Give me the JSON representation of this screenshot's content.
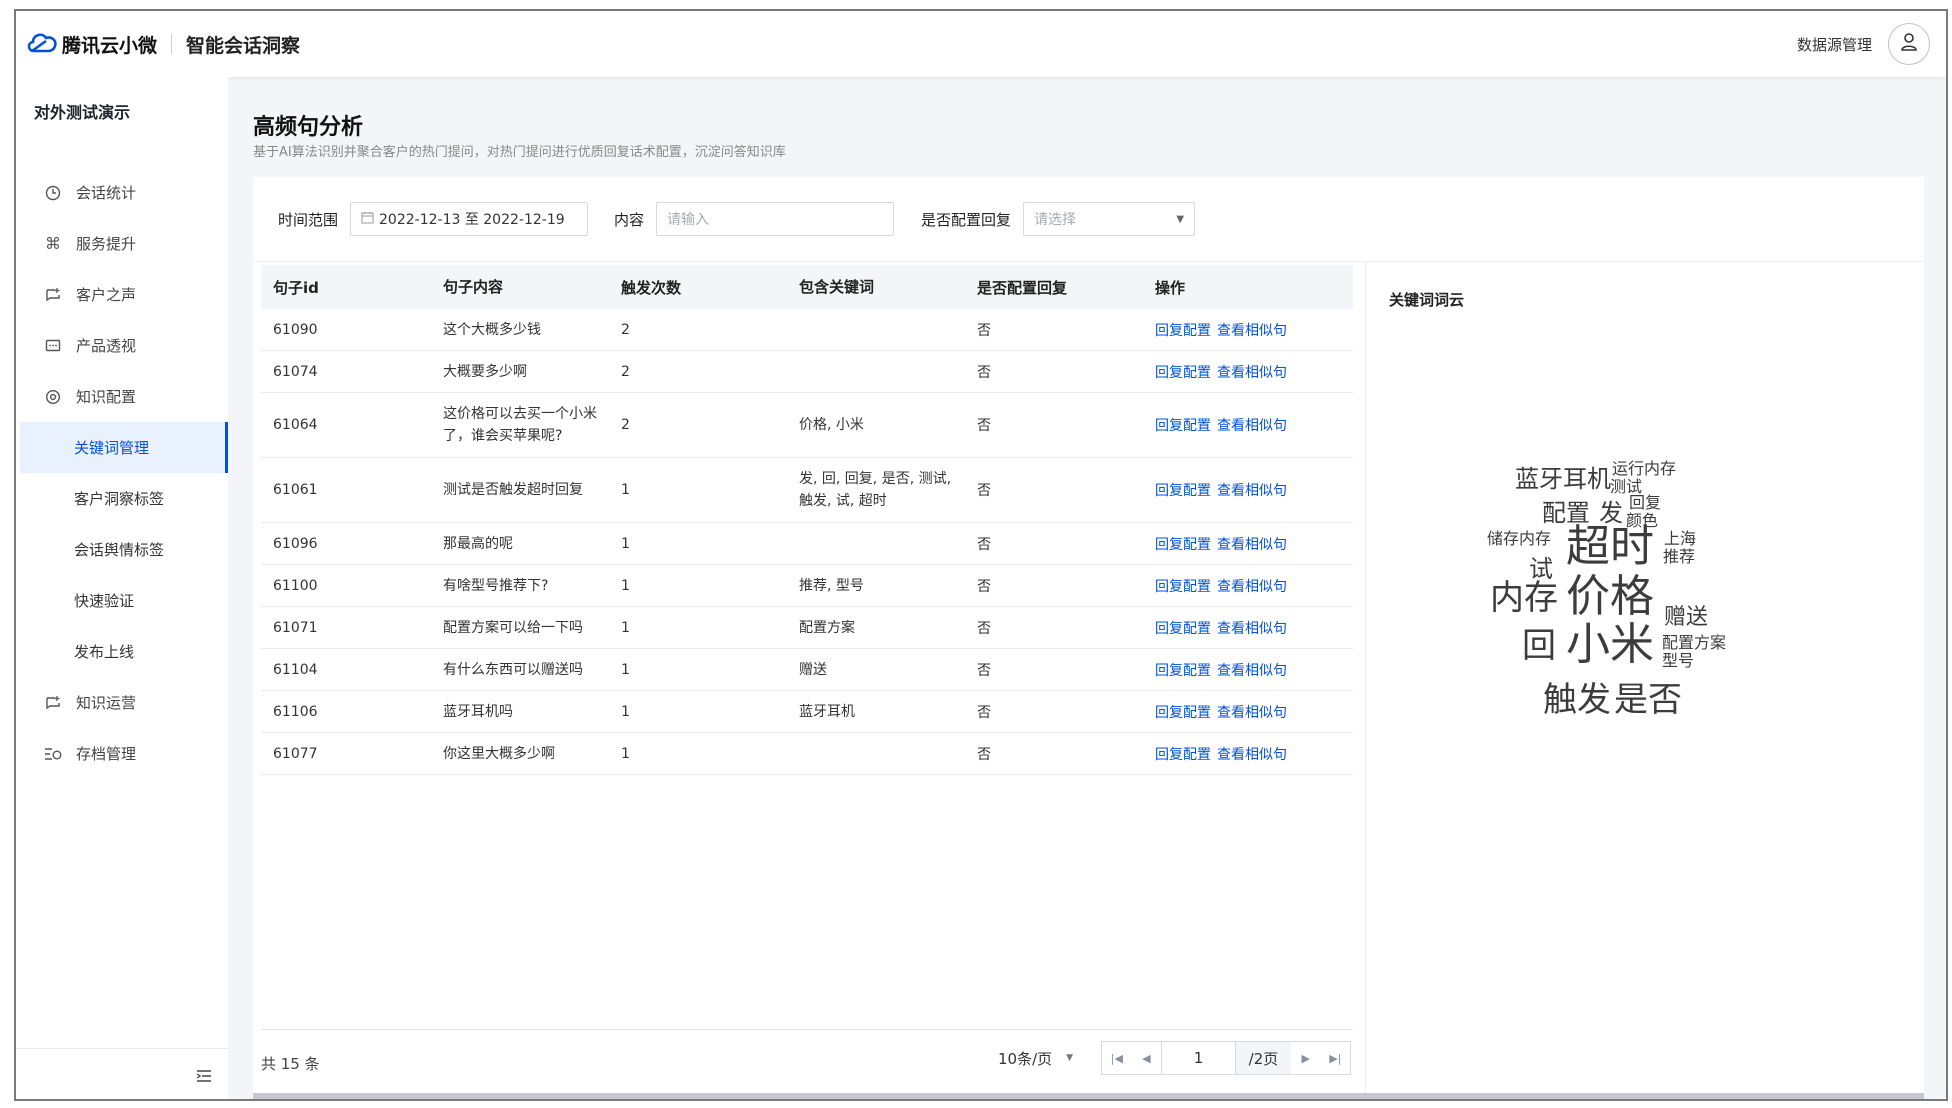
{
  "header": {
    "brand": "腾讯云小微",
    "product": "智能会话洞察",
    "datasource_label": "数据源管理"
  },
  "sidebar": {
    "org": "对外测试演示",
    "items": [
      {
        "label": "会话统计",
        "icon": "clock-icon"
      },
      {
        "label": "服务提升",
        "icon": "command-icon"
      },
      {
        "label": "客户之声",
        "icon": "chat-icon"
      },
      {
        "label": "产品透视",
        "icon": "message-icon"
      },
      {
        "label": "知识配置",
        "icon": "settings-icon"
      },
      {
        "label": "关键词管理",
        "sub": true,
        "active": true
      },
      {
        "label": "客户洞察标签",
        "sub": true
      },
      {
        "label": "会话舆情标签",
        "sub": true
      },
      {
        "label": "快速验证",
        "sub": true
      },
      {
        "label": "发布上线",
        "sub": true
      },
      {
        "label": "知识运营",
        "icon": "chat-icon"
      },
      {
        "label": "存档管理",
        "icon": "archive-icon"
      }
    ]
  },
  "page": {
    "title": "高频句分析",
    "description": "基于AI算法识别并聚合客户的热门提问，对热门提问进行优质回复话术配置，沉淀问答知识库"
  },
  "filters": {
    "time_label": "时间范围",
    "time_value": "2022-12-13 至 2022-12-19",
    "content_label": "内容",
    "content_placeholder": "请输入",
    "reply_label": "是否配置回复",
    "reply_placeholder": "请选择"
  },
  "table": {
    "headers": [
      "句子id",
      "句子内容",
      "触发次数",
      "包含关键词",
      "是否配置回复",
      "操作"
    ],
    "action_config": "回复配置",
    "action_similar": "查看相似句",
    "rows": [
      {
        "id": "61090",
        "content": "这个大概多少钱",
        "count": "2",
        "keywords": "",
        "configured": "否"
      },
      {
        "id": "61074",
        "content": "大概要多少啊",
        "count": "2",
        "keywords": "",
        "configured": "否"
      },
      {
        "id": "61064",
        "content": "这价格可以去买一个小米了，谁会买苹果呢?",
        "count": "2",
        "keywords": "价格, 小米",
        "configured": "否"
      },
      {
        "id": "61061",
        "content": "测试是否触发超时回复",
        "count": "1",
        "keywords": "发, 回, 回复, 是否, 测试, 触发, 试, 超时",
        "configured": "否"
      },
      {
        "id": "61096",
        "content": "那最高的呢",
        "count": "1",
        "keywords": "",
        "configured": "否"
      },
      {
        "id": "61100",
        "content": "有啥型号推荐下?",
        "count": "1",
        "keywords": "推荐, 型号",
        "configured": "否"
      },
      {
        "id": "61071",
        "content": "配置方案可以给一下吗",
        "count": "1",
        "keywords": "配置方案",
        "configured": "否"
      },
      {
        "id": "61104",
        "content": "有什么东西可以赠送吗",
        "count": "1",
        "keywords": "赠送",
        "configured": "否"
      },
      {
        "id": "61106",
        "content": "蓝牙耳机吗",
        "count": "1",
        "keywords": "蓝牙耳机",
        "configured": "否"
      },
      {
        "id": "61077",
        "content": "你这里大概多少啊",
        "count": "1",
        "keywords": "",
        "configured": "否"
      }
    ],
    "total": "共 15 条",
    "page_size": "10条/页",
    "current_page": "1",
    "page_total": "/2页"
  },
  "cloud": {
    "title": "关键词词云",
    "words": [
      {
        "text": "蓝牙耳机",
        "weight": 2
      },
      {
        "text": "运行内存",
        "weight": 1
      },
      {
        "text": "测试",
        "weight": 1
      },
      {
        "text": "配置",
        "weight": 2
      },
      {
        "text": "发",
        "weight": 2
      },
      {
        "text": "回复",
        "weight": 1
      },
      {
        "text": "颜色",
        "weight": 1
      },
      {
        "text": "储存内存",
        "weight": 1
      },
      {
        "text": "超时",
        "weight": 4
      },
      {
        "text": "上海",
        "weight": 1
      },
      {
        "text": "推荐",
        "weight": 1
      },
      {
        "text": "试",
        "weight": 2
      },
      {
        "text": "内存",
        "weight": 3
      },
      {
        "text": "价格",
        "weight": 4
      },
      {
        "text": "赠送",
        "weight": 2
      },
      {
        "text": "回",
        "weight": 3
      },
      {
        "text": "小米",
        "weight": 4
      },
      {
        "text": "配置方案",
        "weight": 1
      },
      {
        "text": "型号",
        "weight": 1
      },
      {
        "text": "触发",
        "weight": 3
      },
      {
        "text": "是否",
        "weight": 3
      }
    ]
  }
}
